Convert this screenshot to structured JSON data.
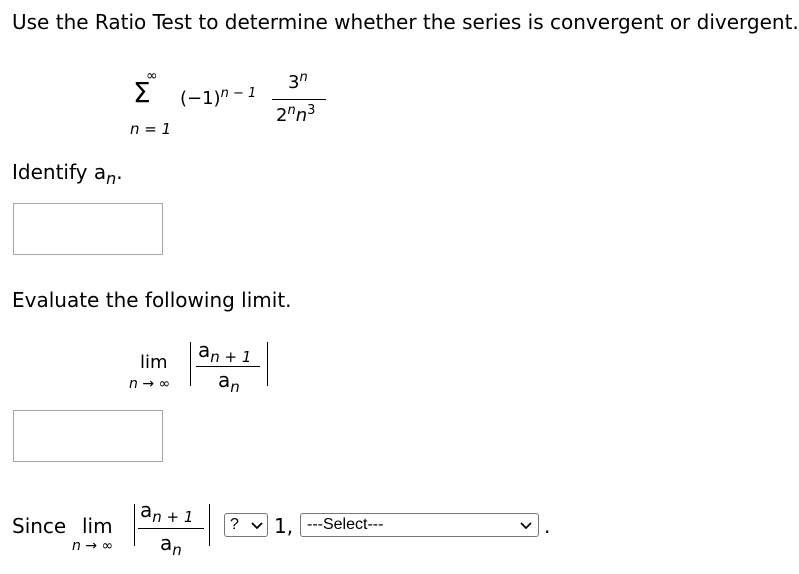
{
  "question": {
    "instruction": "Use the Ratio Test to determine whether the series is convergent or divergent.",
    "series": {
      "sum_symbol": "Σ",
      "upper_limit": "∞",
      "lower_limit": "n = 1",
      "factor": "(−1)",
      "factor_exponent": "n − 1",
      "numerator_base": "3",
      "numerator_exponent": "n",
      "denominator_base_1": "2",
      "denominator_exp_1": "n",
      "denominator_base_2": "n",
      "denominator_exp_2": "3"
    }
  },
  "part1": {
    "label_prefix": "Identify a",
    "label_sub": "n",
    "label_suffix": ".",
    "answer_value": ""
  },
  "part2": {
    "label": "Evaluate the following limit.",
    "lim_word": "lim",
    "lim_under": "n → ∞",
    "numerator_a": "a",
    "numerator_sub": "n + 1",
    "denominator_a": "a",
    "denominator_sub": "n",
    "answer_value": ""
  },
  "part3": {
    "since_label": "Since",
    "lim_word": "lim",
    "lim_under": "n → ∞",
    "numerator_a": "a",
    "numerator_sub": "n + 1",
    "denominator_a": "a",
    "denominator_sub": "n",
    "comparison_select": "?",
    "comparison_value": "1,",
    "conclusion_select": "---Select---",
    "end_period": "."
  }
}
